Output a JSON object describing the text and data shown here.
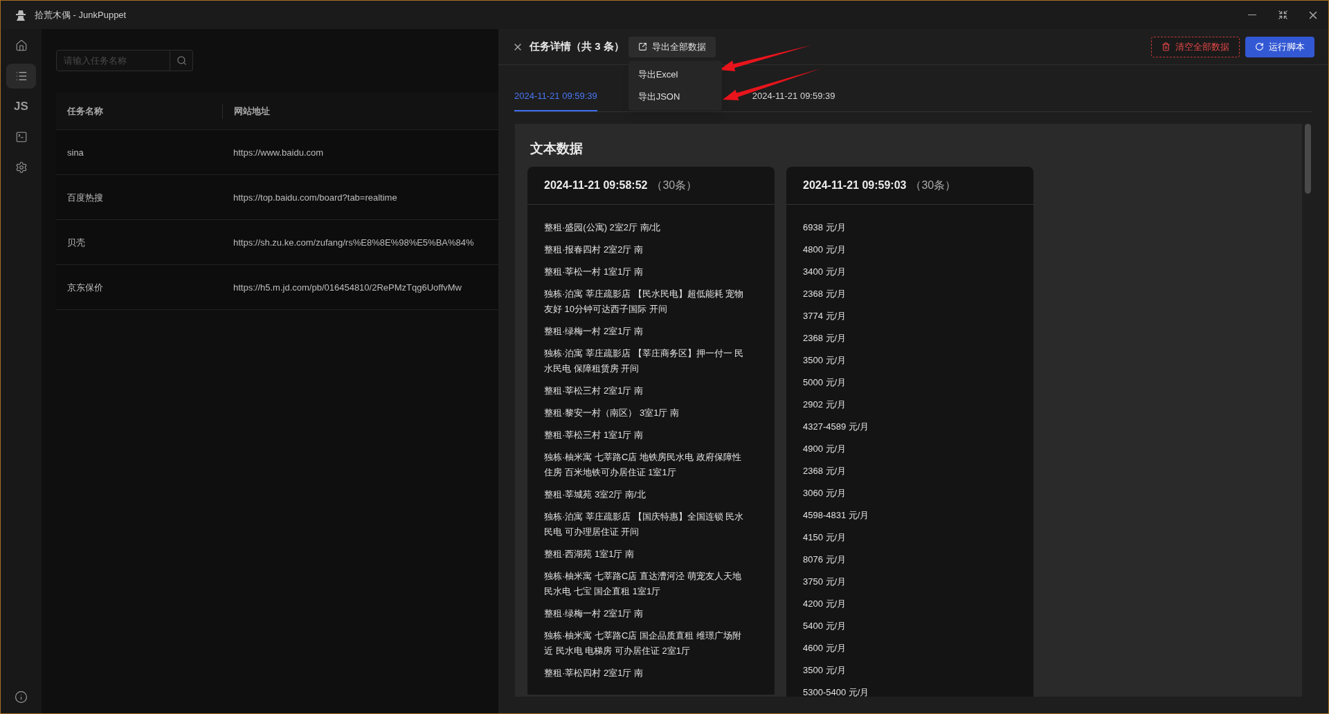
{
  "window": {
    "title": "拾荒木偶 - JunkPuppet"
  },
  "sidebar": {
    "items": [
      {
        "kind": "home",
        "selected": false
      },
      {
        "kind": "list",
        "selected": true
      },
      {
        "kind": "text",
        "label": "JS",
        "selected": false
      },
      {
        "kind": "terminal",
        "selected": false
      },
      {
        "kind": "settings",
        "selected": false
      }
    ],
    "footer": {
      "kind": "info"
    }
  },
  "search": {
    "placeholder": "请输入任务名称"
  },
  "table": {
    "columns": [
      "任务名称",
      "网站地址"
    ],
    "rows": [
      {
        "cells": [
          "sina",
          "https://www.baidu.com"
        ]
      },
      {
        "cells": [
          "百度热搜",
          "https://top.baidu.com/board?tab=realtime"
        ]
      },
      {
        "cells": [
          "贝壳",
          "https://sh.zu.ke.com/zufang/rs%E8%8E%98%E5%BA%84%"
        ]
      },
      {
        "cells": [
          "京东保价",
          "https://h5.m.jd.com/pb/016454810/2RePMzTqg6UoffvMw"
        ]
      }
    ]
  },
  "drawer": {
    "title": "任务详情（共 3 条）",
    "export_button": "导出全部数据",
    "export_menu": {
      "items": [
        "导出Excel",
        "导出JSON"
      ]
    },
    "clear_button": "清空全部数据",
    "run_button": "运行脚本",
    "tabs": [
      {
        "label": "2024-11-21 09:59:39",
        "selected": true
      },
      {
        "label": "2024-11-21 09:59:39",
        "selected": false
      }
    ],
    "section_title": "文本数据",
    "columns": [
      {
        "title": "2024-11-21 09:58:52",
        "count": "（30条）",
        "items": [
          "整租·盛园(公寓) 2室2厅 南/北",
          "整租·报春四村 2室2厅 南",
          "整租·莘松一村 1室1厅 南",
          "独栋·泊寓 莘庄疏影店 【民水民电】超低能耗 宠物友好 10分钟可达西子国际 开间",
          "整租·绿梅一村 2室1厅 南",
          "独栋·泊寓 莘庄疏影店 【莘庄商务区】押一付一 民水民电 保障租赁房 开间",
          "整租·莘松三村 2室1厅 南",
          "整租·黎安一村（南区） 3室1厅 南",
          "整租·莘松三村 1室1厅 南",
          "独栋·柚米寓 七莘路C店 地铁房民水电 政府保障性住房 百米地铁可办居住证 1室1厅",
          "整租·莘城苑 3室2厅 南/北",
          "独栋·泊寓 莘庄疏影店 【国庆特惠】全国连锁 民水民电 可办理居住证 开间",
          "整租·西湖苑 1室1厅 南",
          "独栋·柚米寓 七莘路C店 直达漕河泾 萌宠友人天地民水电 七宝 国企直租 1室1厅",
          "整租·绿梅一村 2室1厅 南",
          "独栋·柚米寓 七莘路C店 国企品质直租 维璟广场附近 民水电 电梯房 可办居住证 2室1厅",
          "整租·莘松四村 2室1厅 南"
        ]
      },
      {
        "title": "2024-11-21 09:59:03",
        "count": "（30条）",
        "items": [
          "6938 元/月",
          "4800 元/月",
          "3400 元/月",
          "2368 元/月",
          "3774 元/月",
          "2368 元/月",
          "3500 元/月",
          "5000 元/月",
          "2902 元/月",
          "4327-4589 元/月",
          "4900 元/月",
          "2368 元/月",
          "3060 元/月",
          "4598-4831 元/月",
          "4150 元/月",
          "8076 元/月",
          "3750 元/月",
          "4200 元/月",
          "5400 元/月",
          "4600 元/月",
          "3500 元/月",
          "5300-5400 元/月"
        ]
      }
    ]
  }
}
